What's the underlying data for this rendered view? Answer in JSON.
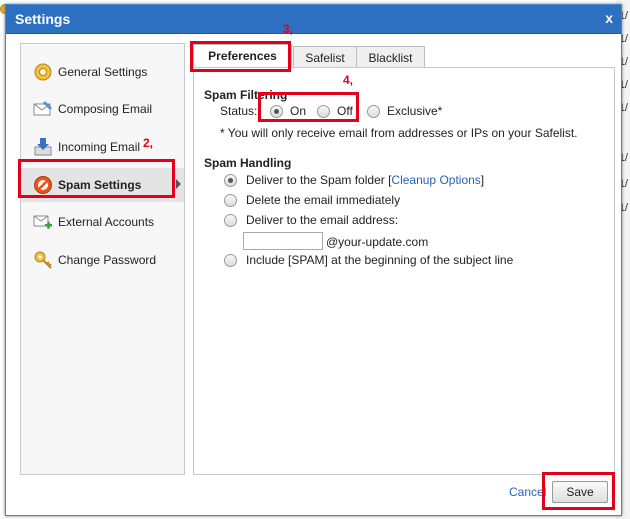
{
  "dialog": {
    "title": "Settings",
    "close_label": "x"
  },
  "sidebar": {
    "items": [
      {
        "label": "General Settings",
        "icon": "gear-icon"
      },
      {
        "label": "Composing Email",
        "icon": "envelope-pen-icon"
      },
      {
        "label": "Incoming Email",
        "icon": "inbox-arrow-icon"
      },
      {
        "label": "Spam Settings",
        "icon": "no-spam-icon",
        "active": true
      },
      {
        "label": "External Accounts",
        "icon": "envelope-plus-icon"
      },
      {
        "label": "Change Password",
        "icon": "key-icon"
      }
    ]
  },
  "tabs": [
    {
      "label": "Preferences",
      "active": true
    },
    {
      "label": "Safelist"
    },
    {
      "label": "Blacklist"
    }
  ],
  "spam_filtering": {
    "title": "Spam Filtering",
    "status_label": "Status:",
    "options": [
      {
        "label": "On",
        "checked": true
      },
      {
        "label": "Off"
      },
      {
        "label": "Exclusive*"
      }
    ],
    "note": "* You will only receive email from addresses or IPs on your Safelist."
  },
  "spam_handling": {
    "title": "Spam Handling",
    "options": [
      {
        "label": "Deliver to the Spam folder",
        "checked": true,
        "link": "Cleanup Options"
      },
      {
        "label": "Delete the email immediately"
      },
      {
        "label": "Deliver to the email address:"
      },
      {
        "label": "Include [SPAM] at the beginning of the subject line"
      }
    ],
    "email_value": "",
    "email_domain": "@your-update.com"
  },
  "footer": {
    "cancel_label": "Cancel",
    "save_label": "Save"
  },
  "annotations": {
    "n2": "2,",
    "n3": "3,",
    "n4": "4,"
  },
  "background": {
    "glyphs": [
      "1/",
      "1/",
      "1/",
      "1/",
      "1/",
      "1/",
      "1/",
      "1/"
    ]
  },
  "colors": {
    "titlebar": "#2d6fc1",
    "highlight": "#e3001b",
    "link": "#2a62b8"
  }
}
